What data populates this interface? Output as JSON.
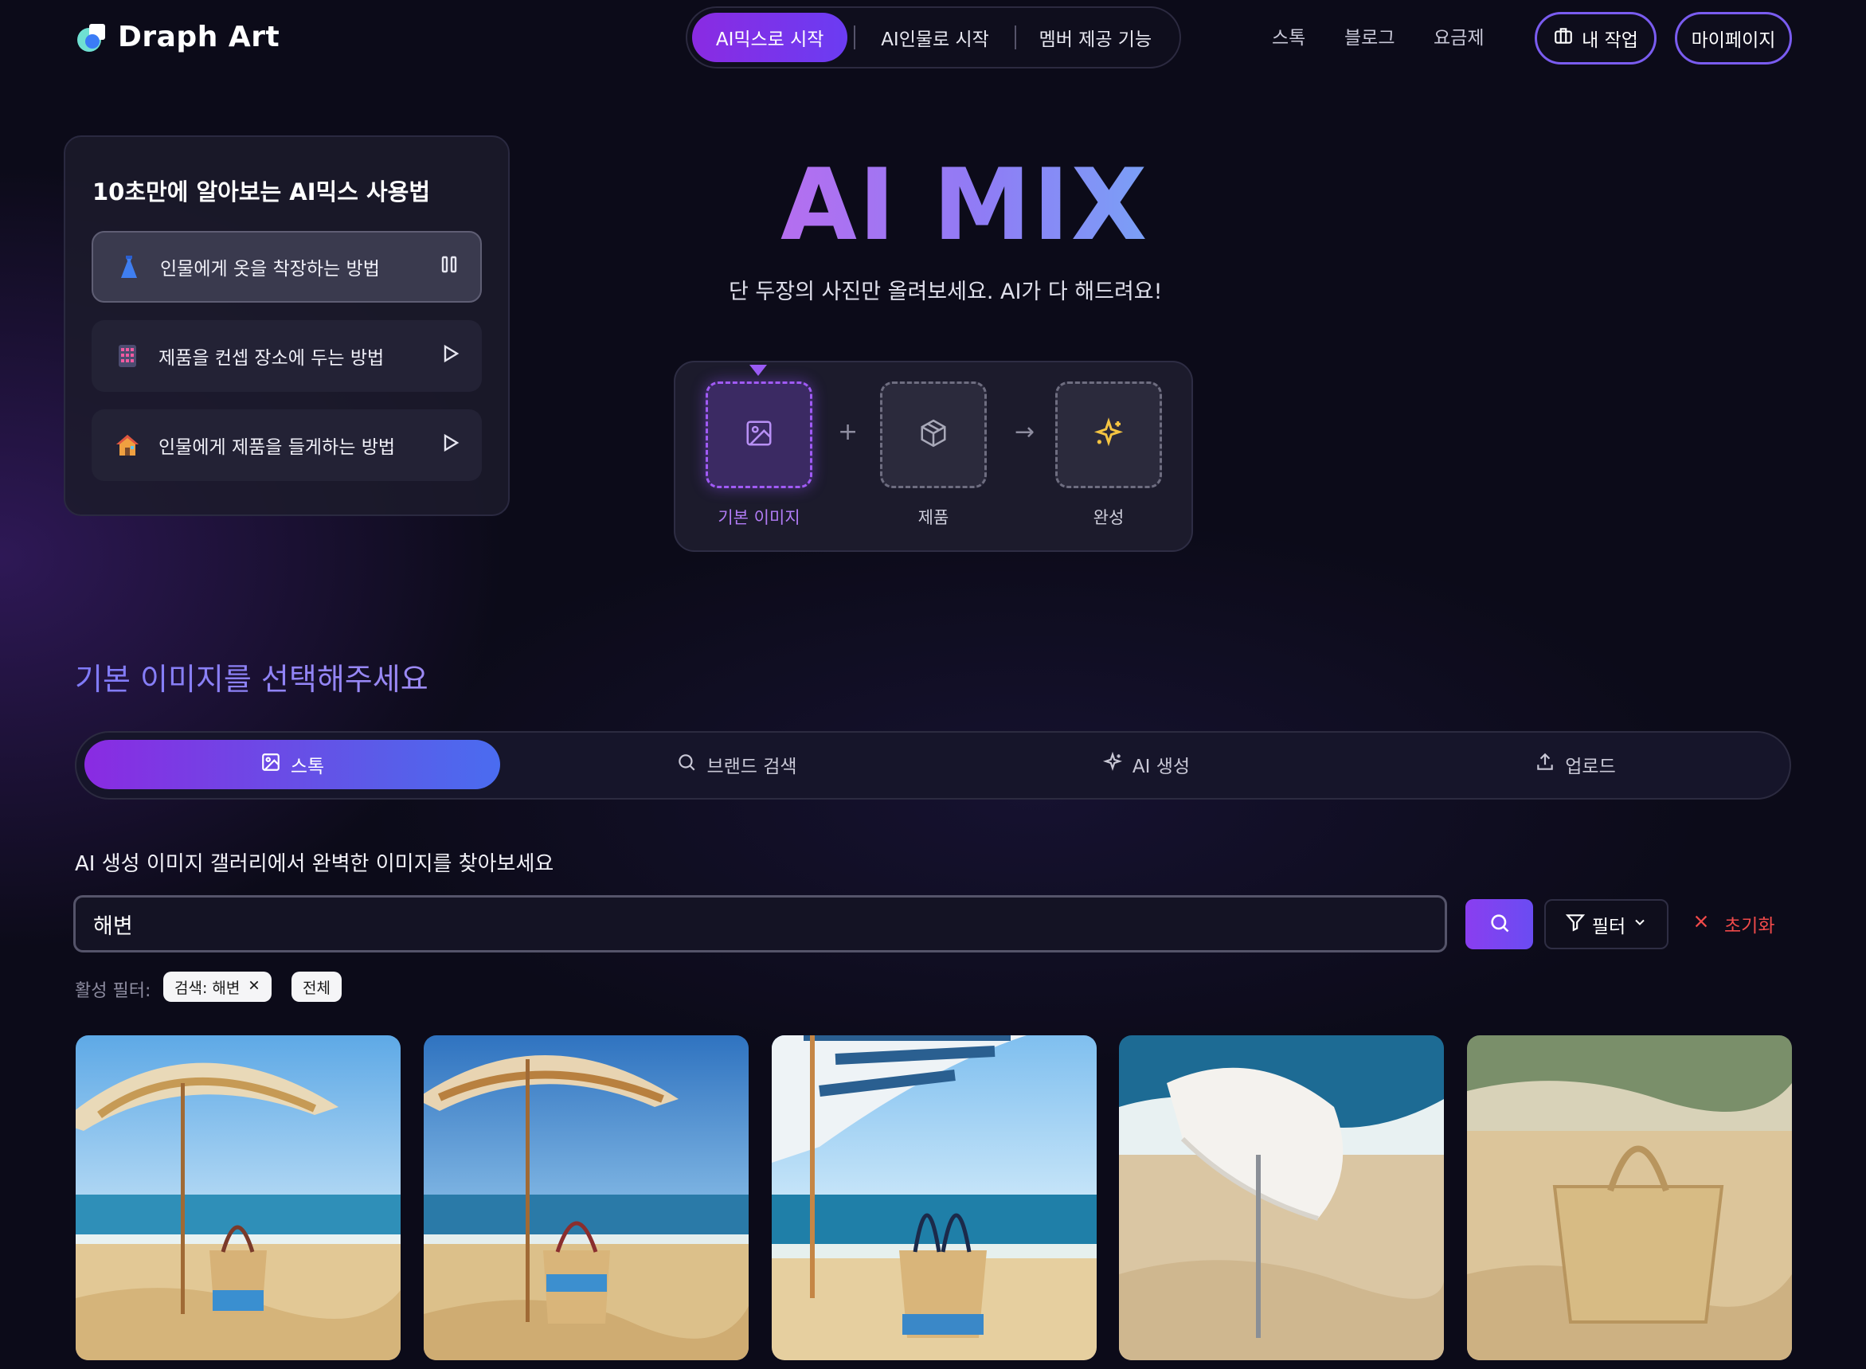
{
  "header": {
    "brand": "Draph Art",
    "modes": [
      "AI믹스로 시작",
      "AI인물로 시작",
      "멤버 제공 기능"
    ],
    "nav": [
      "스톡",
      "블로그",
      "요금제"
    ],
    "my_work": "내 작업",
    "my_page": "마이페이지"
  },
  "tutorial": {
    "title": "10초만에 알아보는 AI믹스 사용법",
    "items": [
      {
        "label": "인물에게 옷을 착장하는 방법",
        "icon": "dress-icon",
        "state": "pause-icon"
      },
      {
        "label": "제품을 컨셉 장소에 두는 방법",
        "icon": "calculator-icon",
        "state": "play-icon"
      },
      {
        "label": "인물에게 제품을 들게하는 방법",
        "icon": "house-icon",
        "state": "play-icon"
      }
    ]
  },
  "hero": {
    "title": "AI MIX",
    "subtitle": "단 두장의 사진만 올려보세요. AI가 다 해드려요!",
    "steps": [
      "기본 이미지",
      "제품",
      "완성"
    ],
    "plus": "+",
    "arrow": "→"
  },
  "section": {
    "title": "기본 이미지를 선택해주세요",
    "tabs": [
      "스톡",
      "브랜드 검색",
      "AI 생성",
      "업로드"
    ],
    "gallery_desc": "AI 생성 이미지 갤러리에서 완벽한 이미지를 찾아보세요",
    "search_value": "해변",
    "filter_label": "필터",
    "reset_label": "초기화",
    "active_filters_label": "활성 필터:",
    "chips": [
      "검색: 해변",
      "전체"
    ]
  },
  "colors": {
    "accent": "#8a2be2",
    "accent_blue": "#4a6cf0",
    "reset_red": "#f04a4a",
    "background": "#0c0b19"
  }
}
